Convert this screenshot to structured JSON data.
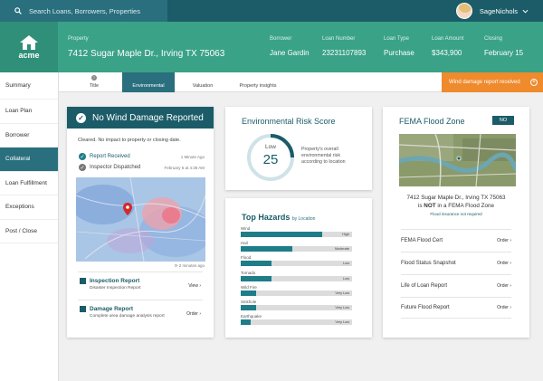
{
  "search": {
    "placeholder": "Search Loans, Borrowers, Properties"
  },
  "user": {
    "name": "SageNichols"
  },
  "logo": {
    "text": "acme"
  },
  "header": {
    "property_label": "Property",
    "property_value": "7412 Sugar Maple Dr., Irving TX 75063",
    "borrower_label": "Borrower",
    "borrower_value": "Jane Gardin",
    "loan_number_label": "Loan Number",
    "loan_number_value": "23231107893",
    "loan_type_label": "Loan Type",
    "loan_type_value": "Purchase",
    "loan_amount_label": "Loan Amount",
    "loan_amount_value": "$343,900",
    "closing_label": "Closing",
    "closing_value": "February 15"
  },
  "sidebar": {
    "items": [
      {
        "label": "Summary"
      },
      {
        "label": "Loan Plan"
      },
      {
        "label": "Borrower"
      },
      {
        "label": "Collateral"
      },
      {
        "label": "Loan Fulfillment"
      },
      {
        "label": "Exceptions"
      },
      {
        "label": "Post / Close"
      }
    ]
  },
  "tabs": [
    {
      "label": "Title"
    },
    {
      "label": "Environmental"
    },
    {
      "label": "Valuation"
    },
    {
      "label": "Property insights"
    }
  ],
  "alert": {
    "text": "Wind damage report received",
    "close": "×"
  },
  "wind": {
    "title": "No Wind Damage Reported",
    "subtitle": "Cleared. No impact to property or closing date.",
    "event1": {
      "label": "Report Received",
      "time": "1 Minute Ago"
    },
    "event2": {
      "label": "Inspector Dispatched",
      "time": "February 6 at 4:38 AM"
    },
    "map_time": "2 minutes ago",
    "reports": [
      {
        "title": "Inspection Report",
        "subtitle": "Disaster Inspection Report",
        "action": "View"
      },
      {
        "title": "Damage Report",
        "subtitle": "Complete area damage analysis report",
        "action": "Order"
      }
    ]
  },
  "env": {
    "title": "Environmental Risk Score",
    "score_label": "Low",
    "score": "25",
    "score_fraction": 0.25,
    "desc": "Property's overall environmental risk according to location"
  },
  "hazards": {
    "title": "Top Hazards",
    "subtitle": "by Location",
    "items": [
      {
        "name": "Wind",
        "level": "High",
        "fraction": 0.73
      },
      {
        "name": "Hail",
        "level": "Moderate",
        "fraction": 0.46
      },
      {
        "name": "Flood",
        "level": "Low",
        "fraction": 0.28
      },
      {
        "name": "Tornado",
        "level": "Low",
        "fraction": 0.28
      },
      {
        "name": "Wild Fire",
        "level": "Very Low",
        "fraction": 0.14
      },
      {
        "name": "Sinkhole",
        "level": "Very Low",
        "fraction": 0.14
      },
      {
        "name": "Earthquake",
        "level": "Very Low",
        "fraction": 0.09
      }
    ]
  },
  "fema": {
    "title": "FEMA Flood Zone",
    "badge": "NO",
    "address": "7412 Sugar Maple Dr., Irving TX 75063",
    "status_pre": "is",
    "status_bold": "NOT",
    "status_post": "in a FEMA Flood Zone",
    "note": "Flood insurance not required",
    "rows": [
      {
        "label": "FEMA Flood Cert",
        "action": "Order"
      },
      {
        "label": "Flood Status Snapshot",
        "action": "Order"
      },
      {
        "label": "Life of Loan Report",
        "action": "Order"
      },
      {
        "label": "Future Flood Report",
        "action": "Order"
      }
    ]
  },
  "colors": {
    "teal_dark": "#1b5c68",
    "green": "#3aa287",
    "orange": "#ef8a2d",
    "bar": "#1e7d88"
  }
}
